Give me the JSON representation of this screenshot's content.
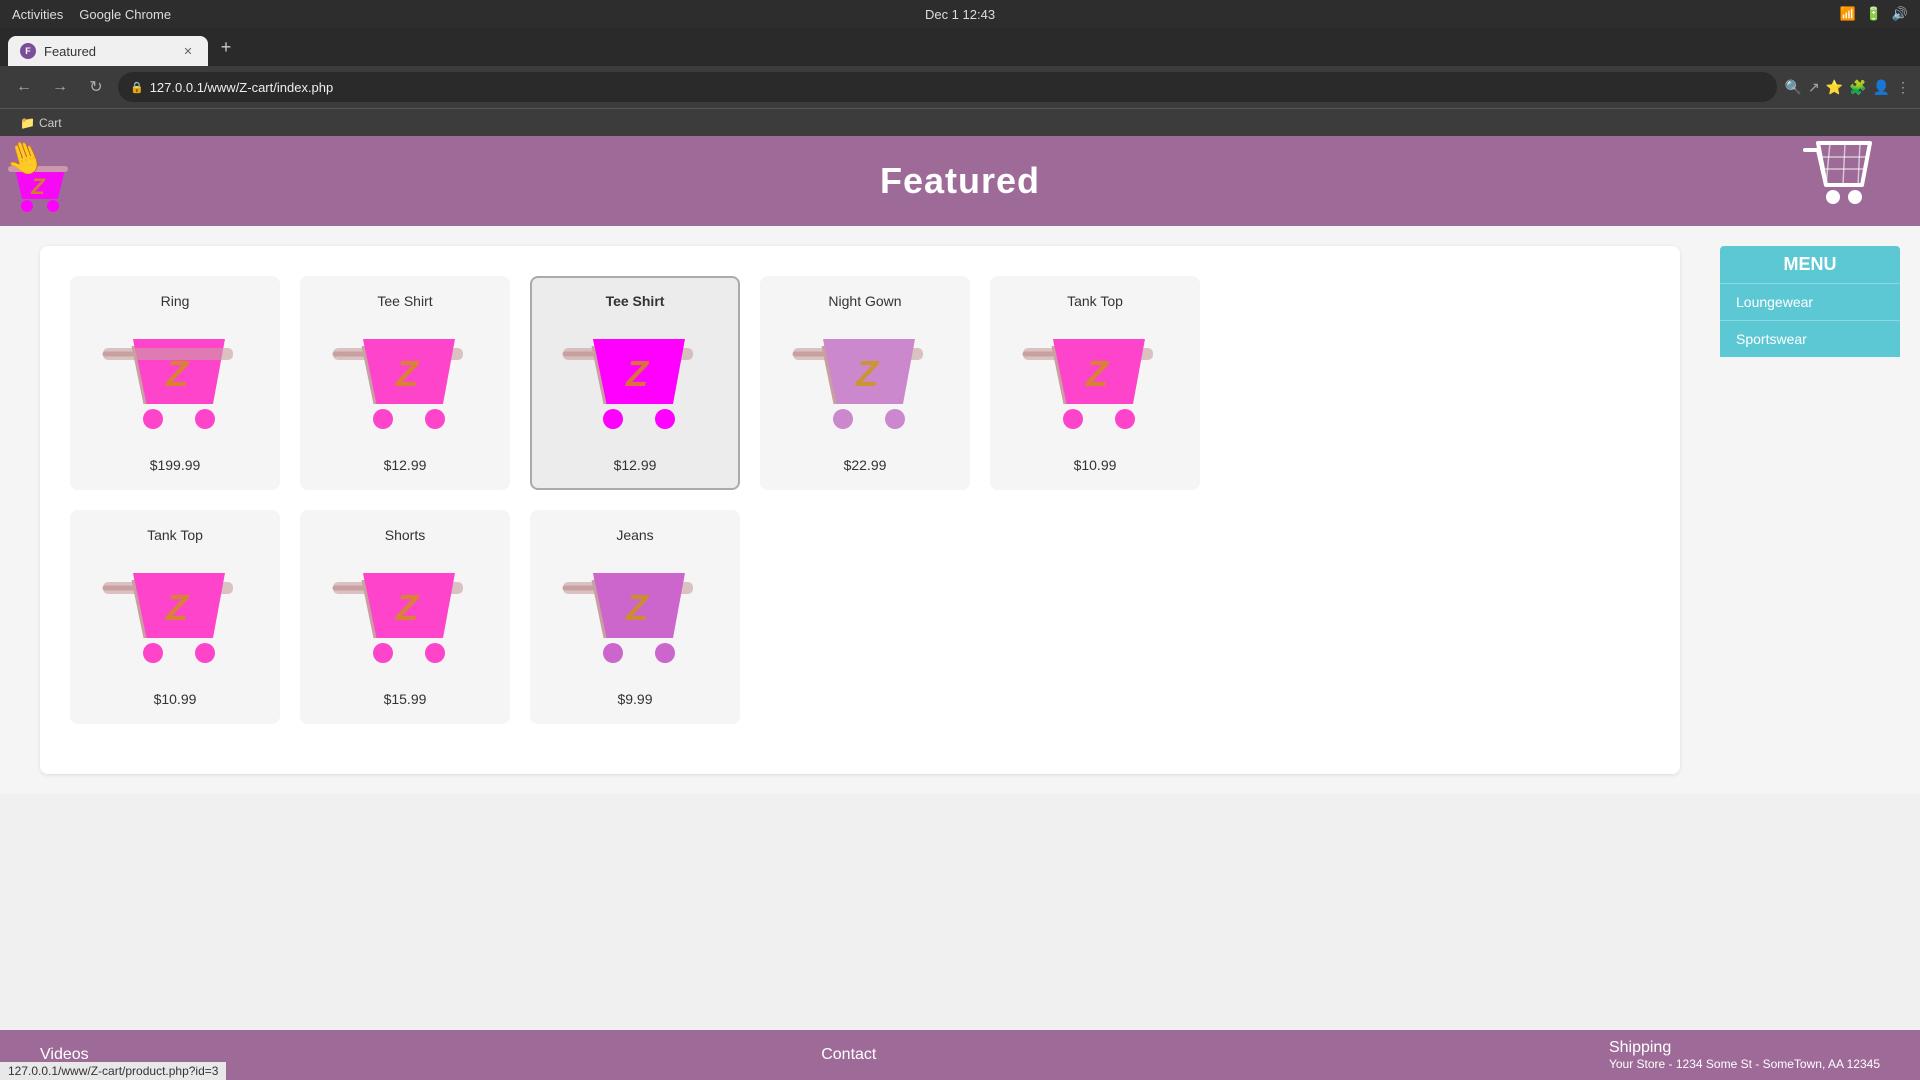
{
  "os": {
    "left": "Activities",
    "browser": "Google Chrome",
    "datetime": "Dec 1  12:43"
  },
  "browser": {
    "tab_title": "Featured",
    "url": "127.0.0.1/www/Z-cart/index.php",
    "bookmark": "Cart",
    "new_tab_label": "+",
    "nav": {
      "back": "←",
      "forward": "→",
      "reload": "↻"
    }
  },
  "header": {
    "title": "Featured",
    "cart_icon": "🛒"
  },
  "menu": {
    "title": "MENU",
    "items": [
      "Loungewear",
      "Sportswear"
    ]
  },
  "products_row1": [
    {
      "name": "Ring",
      "price": "$199.99",
      "selected": false
    },
    {
      "name": "Tee Shirt",
      "price": "$12.99",
      "selected": false
    },
    {
      "name": "Tee Shirt",
      "price": "$12.99",
      "selected": true
    },
    {
      "name": "Night Gown",
      "price": "$22.99",
      "selected": false
    },
    {
      "name": "Tank Top",
      "price": "$10.99",
      "selected": false
    }
  ],
  "products_row2": [
    {
      "name": "Tank Top",
      "price": "$10.99",
      "selected": false
    },
    {
      "name": "Shorts",
      "price": "$15.99",
      "selected": false
    },
    {
      "name": "Jeans",
      "price": "$9.99",
      "selected": false
    }
  ],
  "footer": {
    "videos": "Videos",
    "contact": "Contact",
    "shipping": "Shipping",
    "address": "Your Store - 1234 Some St - SomeTown, AA 12345"
  },
  "status_bar": {
    "url": "127.0.0.1/www/Z-cart/product.php?id=3"
  }
}
